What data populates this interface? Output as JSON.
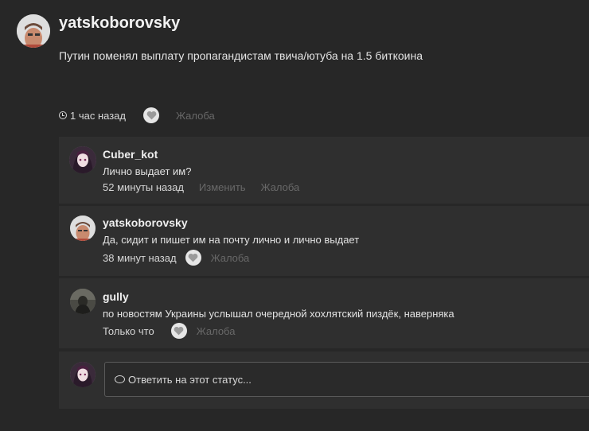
{
  "post": {
    "author": "yatskoborovsky",
    "text": "Путин поменял выплату  пропагандистам твича/ютуба на 1.5 биткоина",
    "time": "1 час назад",
    "report": "Жалоба"
  },
  "comments": [
    {
      "author": "Cuber_kot",
      "text": "Лично выдает им?",
      "time": "52 минуты назад",
      "edit": "Изменить",
      "report": "Жалоба"
    },
    {
      "author": "yatskoborovsky",
      "text": "Да, сидит и пишет им на почту лично и лично выдает",
      "time": "38 минут назад",
      "report": "Жалоба"
    },
    {
      "author": "gully",
      "text": "по новостям Украины услышал очередной хохлятский пиздёк, наверняка",
      "time": "Только что",
      "report": "Жалоба"
    }
  ],
  "reply": {
    "placeholder": "Ответить на этот статус..."
  },
  "icons": {
    "clock": "clock-icon",
    "heart": "heart-icon",
    "comment": "comment-bubble-icon"
  }
}
